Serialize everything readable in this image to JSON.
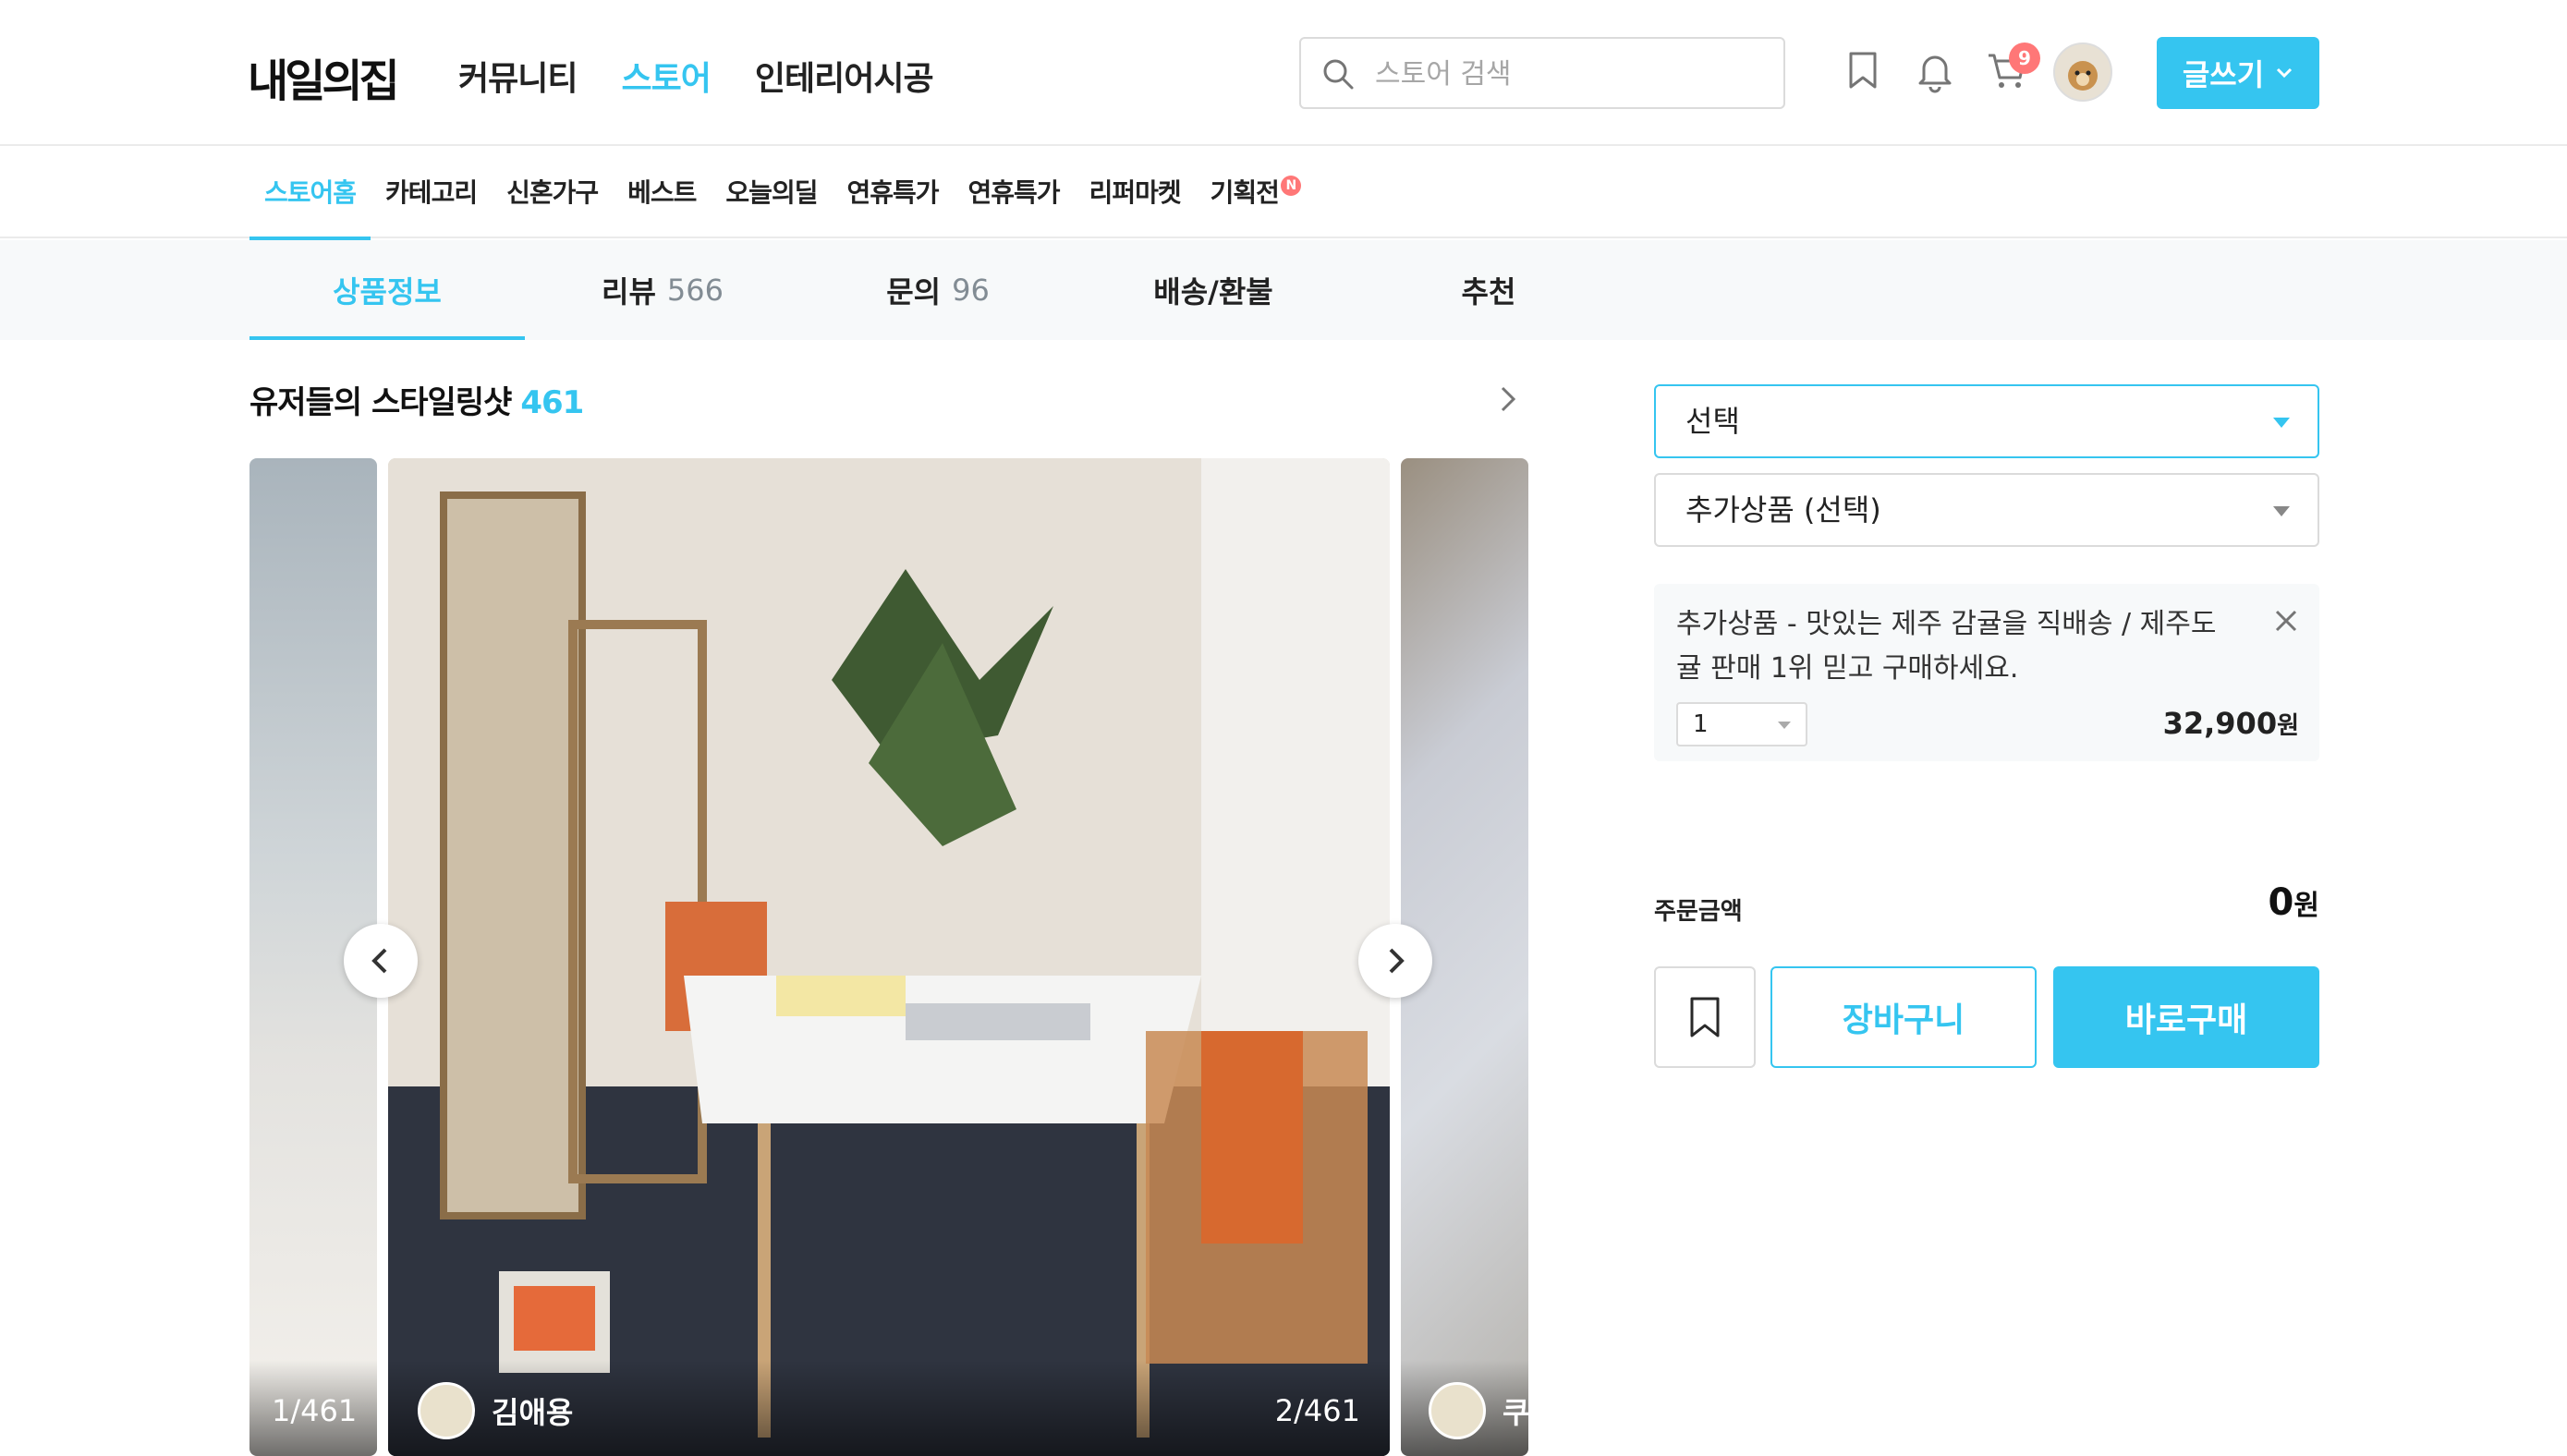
{
  "header": {
    "logo": "내일의집",
    "nav": [
      "커뮤니티",
      "스토어",
      "인테리어시공"
    ],
    "search_placeholder": "스토어 검색",
    "cart_count": "9",
    "write_label": "글쓰기"
  },
  "subnav": {
    "items": [
      "스토어홈",
      "카테고리",
      "신혼가구",
      "베스트",
      "오늘의딜",
      "연휴특가",
      "연휴특가",
      "리퍼마켓",
      "기획전"
    ],
    "new_badge": "N"
  },
  "product_tabs": [
    {
      "label": "상품정보",
      "count": ""
    },
    {
      "label": "리뷰",
      "count": "566"
    },
    {
      "label": "문의",
      "count": "96"
    },
    {
      "label": "배송/환불",
      "count": ""
    },
    {
      "label": "추천",
      "count": ""
    }
  ],
  "styling_shots": {
    "title": "유저들의 스타일링샷",
    "count": "461",
    "shots": [
      {
        "counter": "1/461",
        "user": ""
      },
      {
        "counter": "2/461",
        "user": "김애용"
      },
      {
        "counter": "",
        "user": "쿠"
      }
    ]
  },
  "options": {
    "option_select": "선택",
    "addon_select": "추가상품 (선택)",
    "selected_item": {
      "name": "추가상품 - 맛있는 제주 감귤을 직배송 / 제주도 귤 판매 1위 믿고 구매하세요.",
      "quantity": "1",
      "price": "32,900",
      "unit": "원"
    }
  },
  "order": {
    "label": "주문금액",
    "total": "0",
    "unit": "원",
    "cart_label": "장바구니",
    "buy_label": "바로구매"
  },
  "colors": {
    "accent": "#35c5f0",
    "badge": "#ff7777"
  }
}
